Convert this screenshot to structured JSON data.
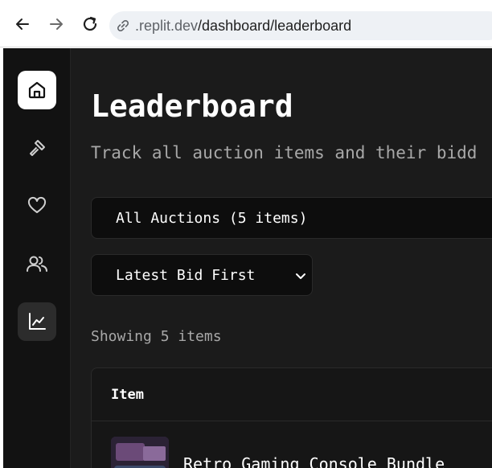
{
  "browser": {
    "url_host": ".replit.dev",
    "url_path": "/dashboard/leaderboard"
  },
  "sidebar": {
    "items": [
      {
        "icon": "home-icon",
        "state": "active"
      },
      {
        "icon": "gavel-icon",
        "state": "default"
      },
      {
        "icon": "heart-icon",
        "state": "default"
      },
      {
        "icon": "users-icon",
        "state": "default"
      },
      {
        "icon": "chart-icon",
        "state": "selected"
      }
    ]
  },
  "page": {
    "title": "Leaderboard",
    "subtitle": "Track all auction items and their bidd"
  },
  "filter": {
    "label": "All Auctions (5 items)"
  },
  "sort": {
    "selected": "Latest Bid First"
  },
  "results": {
    "count_text": "Showing 5 items"
  },
  "table": {
    "headers": [
      "Item"
    ],
    "rows": [
      {
        "name": "Retro Gaming Console Bundle"
      }
    ]
  },
  "colors": {
    "background": "#1b1b1b",
    "sidebar": "#121212",
    "accent": "#ffffff"
  }
}
